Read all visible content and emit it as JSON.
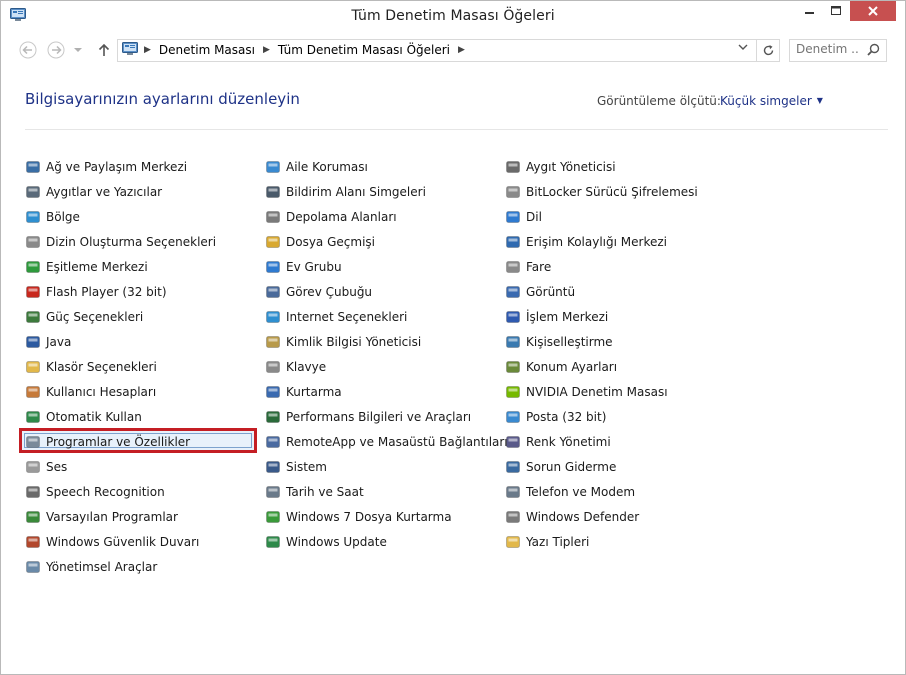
{
  "window": {
    "title": "Tüm Denetim Masası Öğeleri",
    "controls": {
      "minimize": "minimize",
      "maximize": "maximize",
      "close": "close"
    }
  },
  "address": {
    "crumbs": [
      "Denetim Masası",
      "Tüm Denetim Masası Öğeleri"
    ],
    "search_placeholder": "Denetim ..."
  },
  "header": {
    "heading": "Bilgisayarınızın ayarlarını düzenleyin",
    "view_by_label": "Görüntüleme ölçütü:",
    "view_mode": "Küçük simgeler"
  },
  "columns": [
    [
      {
        "label": "Ağ ve Paylaşım Merkezi",
        "icon": "network-icon",
        "color": "#3a6ea5"
      },
      {
        "label": "Aygıtlar ve Yazıcılar",
        "icon": "printer-icon",
        "color": "#5a6a7a"
      },
      {
        "label": "Bölge",
        "icon": "globe-clock-icon",
        "color": "#2f8fd0"
      },
      {
        "label": "Dizin Oluşturma Seçenekleri",
        "icon": "indexing-icon",
        "color": "#8a8a8a"
      },
      {
        "label": "Eşitleme Merkezi",
        "icon": "sync-icon",
        "color": "#2e9a3c"
      },
      {
        "label": "Flash Player (32 bit)",
        "icon": "flash-icon",
        "color": "#c8281e"
      },
      {
        "label": "Güç Seçenekleri",
        "icon": "power-icon",
        "color": "#3c7a3c"
      },
      {
        "label": "Java",
        "icon": "java-icon",
        "color": "#2c5aa0"
      },
      {
        "label": "Klasör Seçenekleri",
        "icon": "folder-icon",
        "color": "#e2b84a"
      },
      {
        "label": "Kullanıcı Hesapları",
        "icon": "users-icon",
        "color": "#c67a3a"
      },
      {
        "label": "Otomatik Kullan",
        "icon": "autoplay-icon",
        "color": "#2e8a4a"
      },
      {
        "label": "Programlar ve Özellikler",
        "icon": "programs-icon",
        "color": "#7a8a9a",
        "selected": true
      },
      {
        "label": "Ses",
        "icon": "speaker-icon",
        "color": "#9a9a9a"
      },
      {
        "label": "Speech Recognition",
        "icon": "microphone-icon",
        "color": "#6a6a6a"
      },
      {
        "label": "Varsayılan Programlar",
        "icon": "default-programs-icon",
        "color": "#3a8a3a"
      },
      {
        "label": "Windows Güvenlik Duvarı",
        "icon": "firewall-icon",
        "color": "#b2472c"
      },
      {
        "label": "Yönetimsel Araçlar",
        "icon": "admin-tools-icon",
        "color": "#6a8aa8"
      }
    ],
    [
      {
        "label": "Aile Koruması",
        "icon": "family-icon",
        "color": "#3a8ad0"
      },
      {
        "label": "Bildirim Alanı Simgeleri",
        "icon": "notification-icon",
        "color": "#4a5a6a"
      },
      {
        "label": "Depolama Alanları",
        "icon": "storage-icon",
        "color": "#7a7a7a"
      },
      {
        "label": "Dosya Geçmişi",
        "icon": "file-history-icon",
        "color": "#d8a830"
      },
      {
        "label": "Ev Grubu",
        "icon": "homegroup-icon",
        "color": "#2f7ad0"
      },
      {
        "label": "Görev Çubuğu",
        "icon": "taskbar-icon",
        "color": "#4a6a9a"
      },
      {
        "label": "Internet Seçenekleri",
        "icon": "internet-icon",
        "color": "#2f8fd0"
      },
      {
        "label": "Kimlik Bilgisi Yöneticisi",
        "icon": "credential-icon",
        "color": "#b89a4a"
      },
      {
        "label": "Klavye",
        "icon": "keyboard-icon",
        "color": "#8a8a8a"
      },
      {
        "label": "Kurtarma",
        "icon": "recovery-icon",
        "color": "#3a6ab0"
      },
      {
        "label": "Performans Bilgileri ve Araçları",
        "icon": "performance-icon",
        "color": "#2a6a3a"
      },
      {
        "label": "RemoteApp ve Masaüstü Bağlantıları",
        "icon": "remoteapp-icon",
        "color": "#4a6aa0"
      },
      {
        "label": "Sistem",
        "icon": "system-icon",
        "color": "#3a5a8a"
      },
      {
        "label": "Tarih ve Saat",
        "icon": "clock-icon",
        "color": "#6a7a8a"
      },
      {
        "label": "Windows 7 Dosya Kurtarma",
        "icon": "file-recovery-icon",
        "color": "#3a9a3a"
      },
      {
        "label": "Windows Update",
        "icon": "update-icon",
        "color": "#2e8a4a"
      }
    ],
    [
      {
        "label": "Aygıt Yöneticisi",
        "icon": "device-manager-icon",
        "color": "#6a6a6a"
      },
      {
        "label": "BitLocker Sürücü Şifrelemesi",
        "icon": "bitlocker-icon",
        "color": "#8a8a8a"
      },
      {
        "label": "Dil",
        "icon": "language-icon",
        "color": "#2f7ad0"
      },
      {
        "label": "Erişim Kolaylığı Merkezi",
        "icon": "accessibility-icon",
        "color": "#2f6ab0"
      },
      {
        "label": "Fare",
        "icon": "mouse-icon",
        "color": "#8a8a8a"
      },
      {
        "label": "Görüntü",
        "icon": "display-icon",
        "color": "#3a6ab0"
      },
      {
        "label": "İşlem Merkezi",
        "icon": "action-center-icon",
        "color": "#2f5ab0"
      },
      {
        "label": "Kişiselleştirme",
        "icon": "personalization-icon",
        "color": "#3a7ab0"
      },
      {
        "label": "Konum Ayarları",
        "icon": "location-icon",
        "color": "#6a8a3a"
      },
      {
        "label": "NVIDIA Denetim Masası",
        "icon": "nvidia-icon",
        "color": "#76b900"
      },
      {
        "label": "Posta (32 bit)",
        "icon": "mail-icon",
        "color": "#3a8ad0"
      },
      {
        "label": "Renk Yönetimi",
        "icon": "color-management-icon",
        "color": "#5a5a8a"
      },
      {
        "label": "Sorun Giderme",
        "icon": "troubleshoot-icon",
        "color": "#3a6aa0"
      },
      {
        "label": "Telefon ve Modem",
        "icon": "phone-icon",
        "color": "#6a7a8a"
      },
      {
        "label": "Windows Defender",
        "icon": "defender-icon",
        "color": "#7a7a7a"
      },
      {
        "label": "Yazı Tipleri",
        "icon": "fonts-icon",
        "color": "#e2b84a"
      }
    ]
  ]
}
